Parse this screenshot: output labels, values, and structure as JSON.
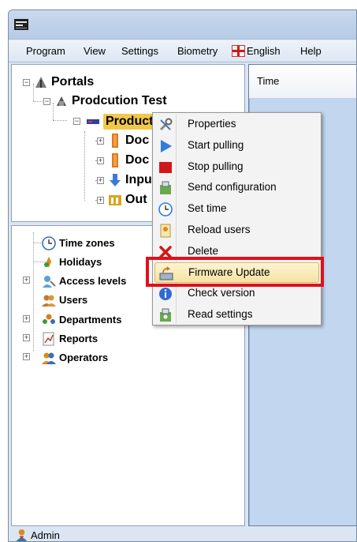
{
  "menubar": {
    "items": [
      "Program",
      "View",
      "Settings",
      "Biometry",
      "English",
      "Help"
    ]
  },
  "tree_top": {
    "portals": "Portals",
    "site": "Prodcution Test",
    "controller": "Production",
    "children": [
      "Doc",
      "Doc",
      "Inpu",
      "Out"
    ]
  },
  "tree_bottom": {
    "items": [
      "Time zones",
      "Holidays",
      "Access levels",
      "Users",
      "Departments",
      "Reports",
      "Operators"
    ]
  },
  "right_panel": {
    "column_header": "Time"
  },
  "context_menu": {
    "items": [
      {
        "label": "Properties",
        "icon": "tools-icon"
      },
      {
        "label": "Start pulling",
        "icon": "play-icon"
      },
      {
        "label": "Stop pulling",
        "icon": "stop-icon"
      },
      {
        "label": "Send configuration",
        "icon": "send-config-icon"
      },
      {
        "label": "Set time",
        "icon": "clock-icon"
      },
      {
        "label": "Reload users",
        "icon": "reload-users-icon"
      },
      {
        "label": "Delete",
        "icon": "delete-icon"
      },
      {
        "label": "Firmware Update",
        "icon": "firmware-icon"
      },
      {
        "label": "Check version",
        "icon": "info-icon"
      },
      {
        "label": "Read settings",
        "icon": "read-settings-icon"
      }
    ],
    "highlighted_item": "Firmware Update"
  },
  "status": {
    "user": "Admin"
  },
  "colors": {
    "highlight_border": "#e0101c",
    "selected_node": "#f2c84b",
    "right_panel_bg": "#c3d6ef"
  }
}
